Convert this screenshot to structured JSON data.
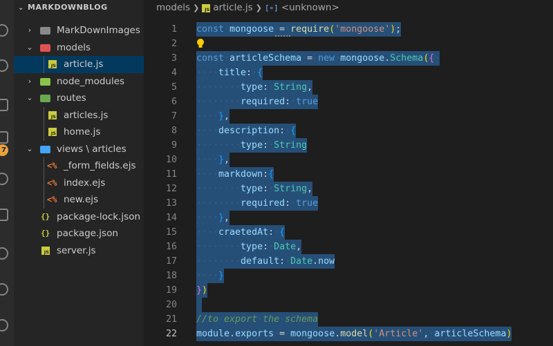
{
  "explorer": {
    "title": "MARKDOWNBLOG",
    "items": [
      {
        "label": "MarkDownImages"
      },
      {
        "label": "models"
      },
      {
        "label": "article.js"
      },
      {
        "label": "node_modules"
      },
      {
        "label": "routes"
      },
      {
        "label": "articles.js"
      },
      {
        "label": "home.js"
      },
      {
        "label": "views \\ articles"
      },
      {
        "label": "_form_fields.ejs"
      },
      {
        "label": "index.ejs"
      },
      {
        "label": "new.ejs"
      },
      {
        "label": "package-lock.json"
      },
      {
        "label": "package.json"
      },
      {
        "label": "server.js"
      }
    ]
  },
  "breadcrumb": {
    "folder": "models",
    "file": "article.js",
    "symbol": "<unknown>"
  },
  "activity": {
    "badge": "7"
  },
  "editor": {
    "line_numbers": [
      "1",
      "2",
      "3",
      "4",
      "5",
      "6",
      "7",
      "8",
      "9",
      "10",
      "11",
      "12",
      "13",
      "14",
      "15",
      "16",
      "17",
      "18",
      "19",
      "20",
      "21",
      "22"
    ],
    "current_line": "22"
  },
  "colors": {
    "selection": "#264f78",
    "sidebar_selected": "#04395e",
    "keyword": "#569cd6",
    "string": "#ce9178",
    "function": "#dcdcaa",
    "class": "#4ec9b0",
    "property": "#9cdcfe",
    "comment": "#6a9955"
  }
}
